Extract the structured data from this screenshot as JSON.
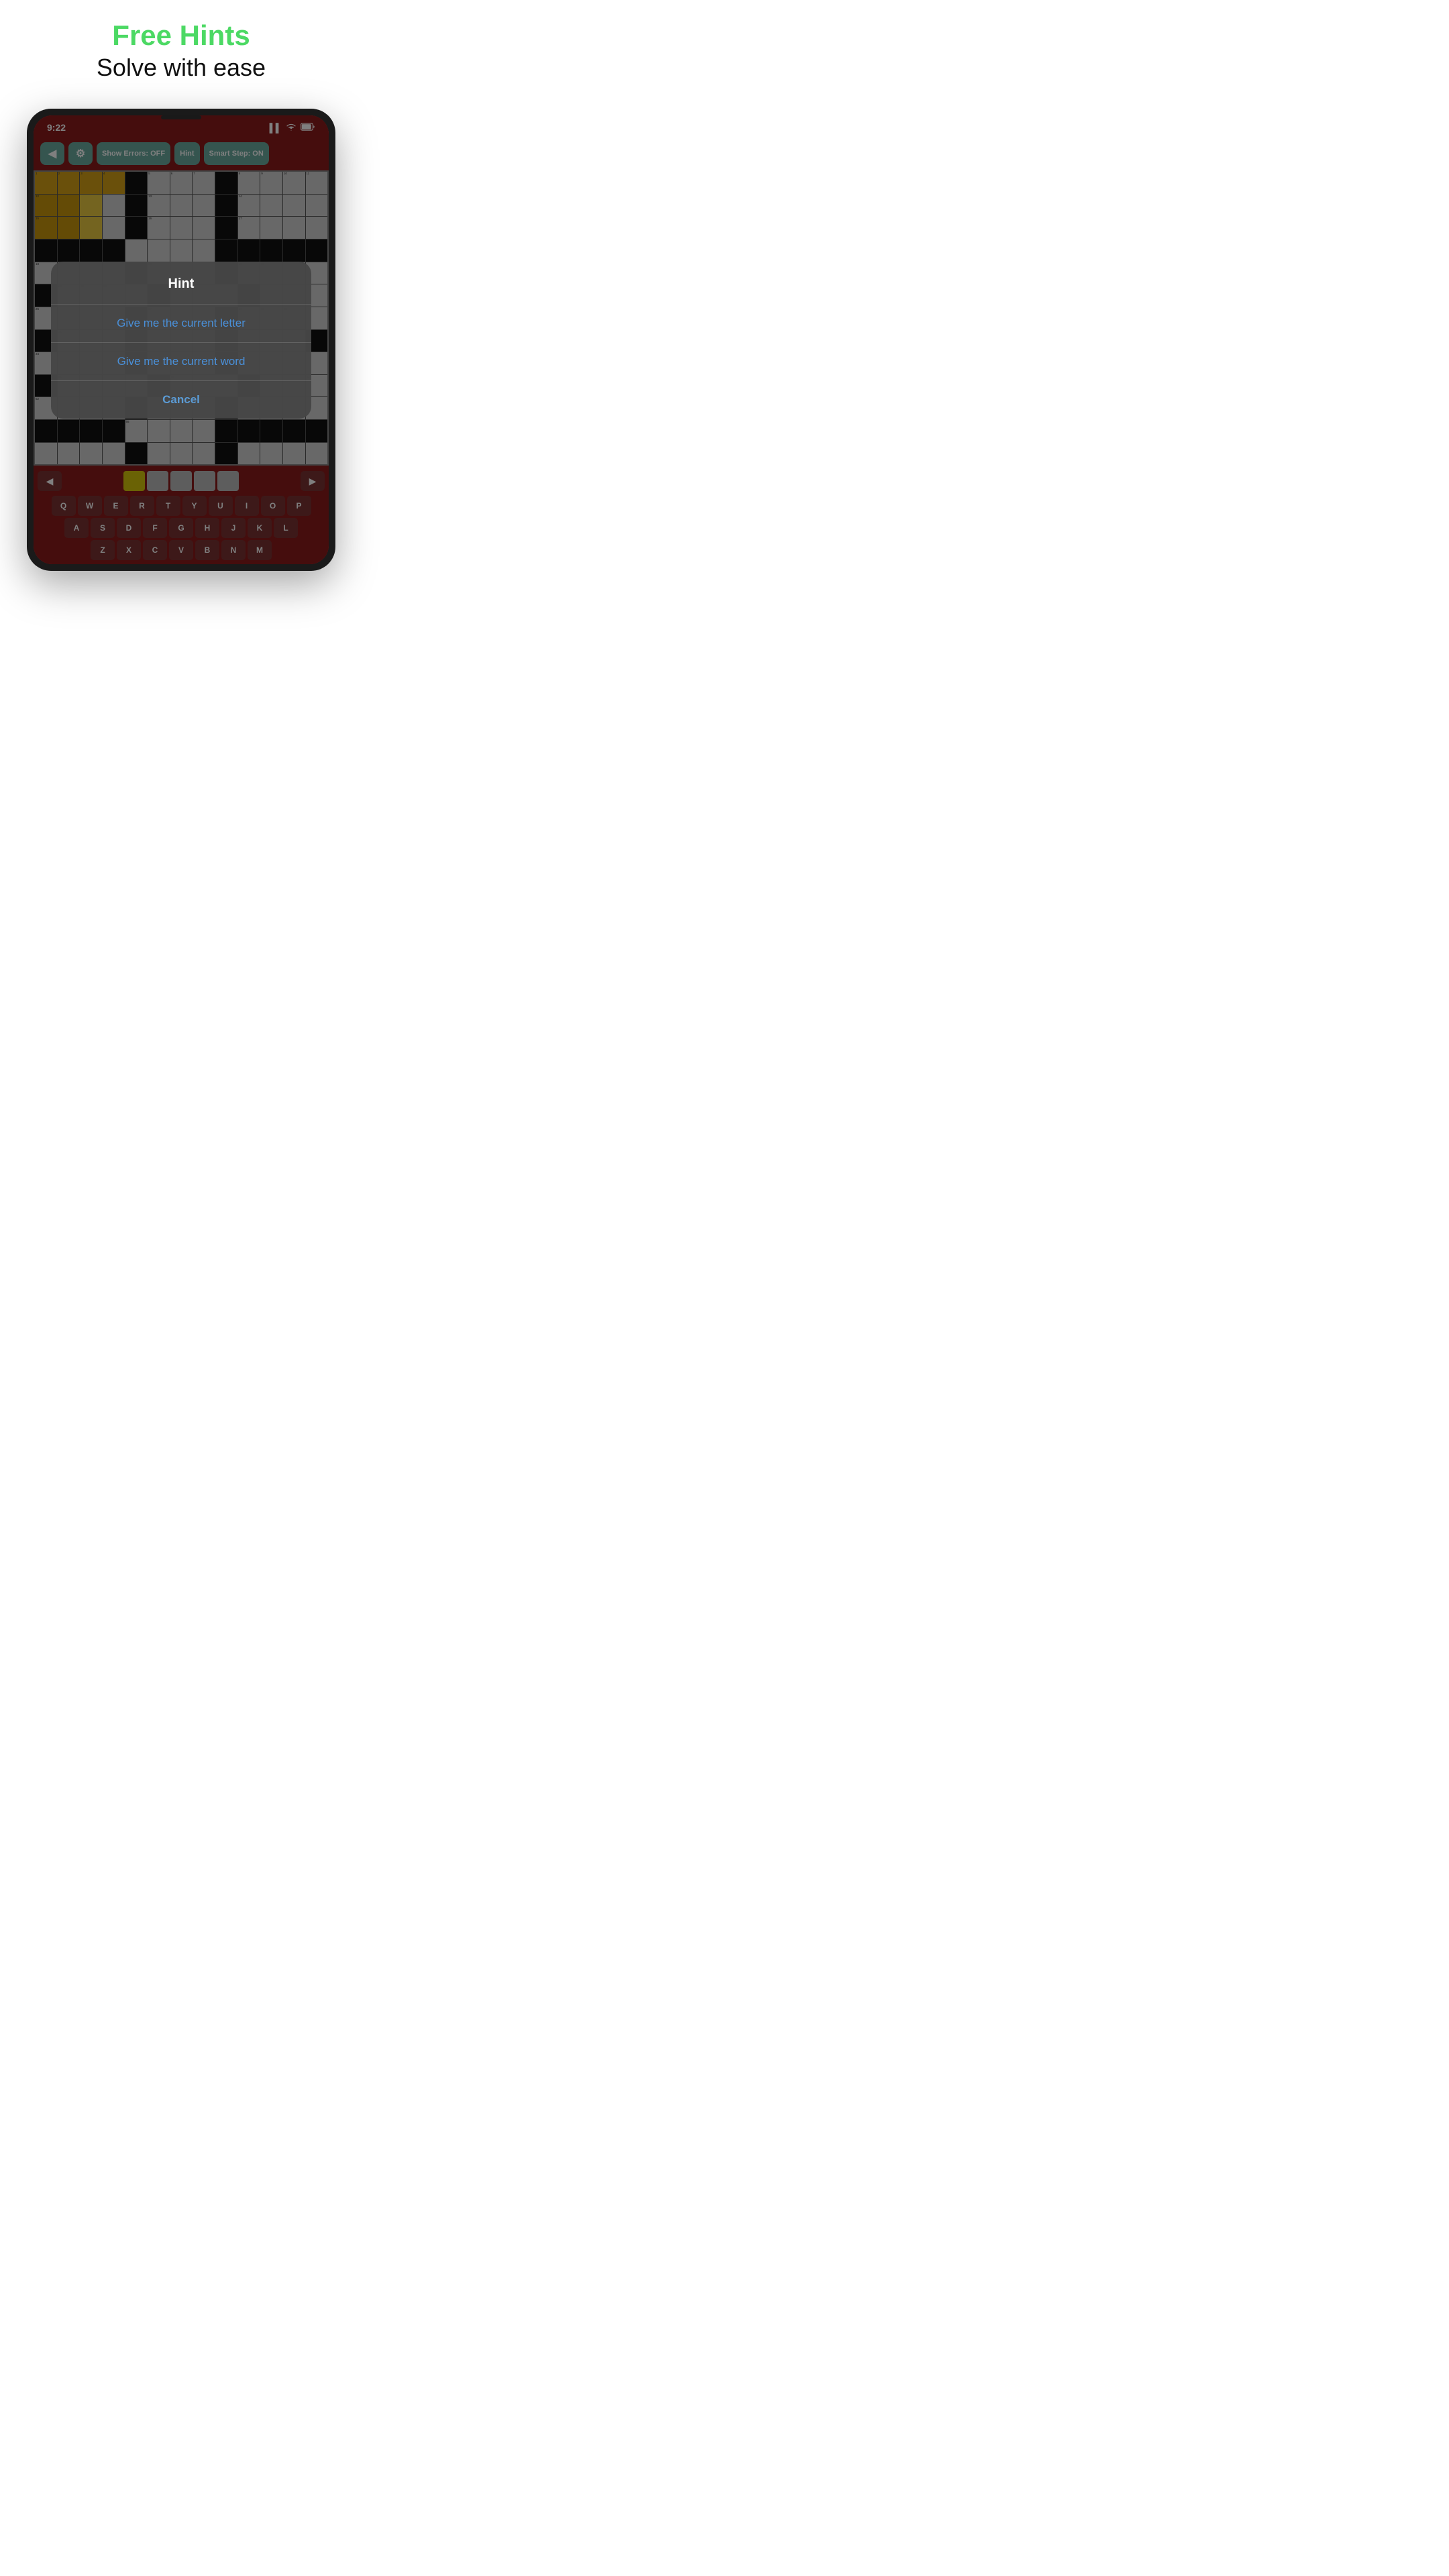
{
  "header": {
    "title": "Free Hints",
    "subtitle": "Solve with ease"
  },
  "status_bar": {
    "time": "9:22",
    "signal": "▌▌",
    "wifi": "wifi",
    "battery": "▭"
  },
  "toolbar": {
    "back_label": "◀",
    "settings_label": "⚙",
    "show_errors_label": "Show Errors: OFF",
    "hint_label": "Hint",
    "smart_step_label": "Smart Step: ON"
  },
  "hint_modal": {
    "title": "Hint",
    "option1": "Give me the current letter",
    "option2": "Give me the current word",
    "cancel": "Cancel"
  },
  "keyboard": {
    "row1": [
      "Q",
      "W",
      "E",
      "R",
      "T",
      "Y",
      "U",
      "I",
      "O",
      "P"
    ],
    "row2": [
      "A",
      "S",
      "D",
      "F",
      "G",
      "H",
      "J",
      "K",
      "L"
    ],
    "row3": [
      "Z",
      "X",
      "C",
      "V",
      "B",
      "N",
      "M"
    ]
  }
}
